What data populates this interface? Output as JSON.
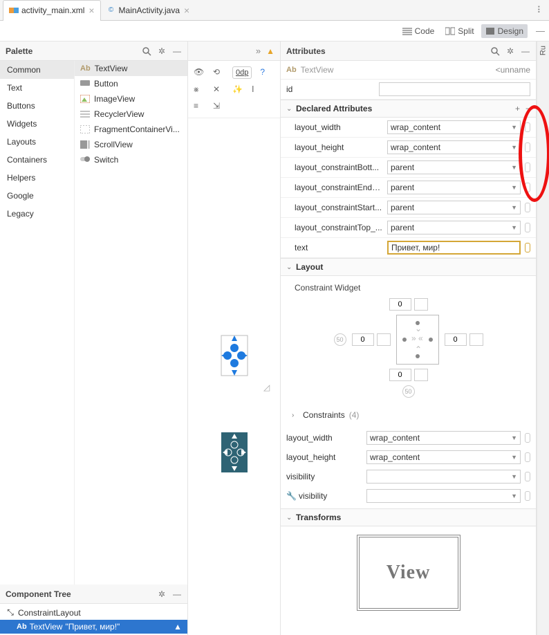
{
  "tabs": [
    {
      "label": "activity_main.xml",
      "active": true,
      "icon_color_a": "#ec9b3b",
      "icon_color_b": "#4aa0e0"
    },
    {
      "label": "MainActivity.java",
      "active": false
    }
  ],
  "right_panel_label": "Ru",
  "view_modes": {
    "code": "Code",
    "split": "Split",
    "design": "Design"
  },
  "palette": {
    "title": "Palette",
    "categories": [
      "Common",
      "Text",
      "Buttons",
      "Widgets",
      "Layouts",
      "Containers",
      "Helpers",
      "Google",
      "Legacy"
    ],
    "selected_category": "Common",
    "items": [
      "TextView",
      "Button",
      "ImageView",
      "RecyclerView",
      "FragmentContainerVi...",
      "ScrollView",
      "Switch"
    ],
    "selected_item": "TextView"
  },
  "component_tree": {
    "title": "Component Tree",
    "root": "ConstraintLayout",
    "child_label": "TextView",
    "child_text": "\"Привет, мир!\""
  },
  "canvas_toolbar": {
    "dp": "0dp"
  },
  "attributes": {
    "panel_title": "Attributes",
    "element_type": "TextView",
    "unnamed": "<unname",
    "id_label": "id",
    "id_value": "",
    "declared_title": "Declared Attributes",
    "declared": [
      {
        "name": "layout_width",
        "value": "wrap_content"
      },
      {
        "name": "layout_height",
        "value": "wrap_content"
      },
      {
        "name": "layout_constraintBott...",
        "value": "parent"
      },
      {
        "name": "layout_constraintEnd_...",
        "value": "parent"
      },
      {
        "name": "layout_constraintStart...",
        "value": "parent"
      },
      {
        "name": "layout_constraintTop_...",
        "value": "parent"
      }
    ],
    "text_attr": {
      "name": "text",
      "value": "Привет, мир!"
    },
    "layout_title": "Layout",
    "constraint_widget_title": "Constraint Widget",
    "cw_values": {
      "top": "0",
      "left": "0",
      "right": "0",
      "bottom": "0",
      "bias_v": "50",
      "bias_h": "50"
    },
    "constraints_title": "Constraints",
    "constraints_count": "(4)",
    "layout_attrs": [
      {
        "name": "layout_width",
        "value": "wrap_content"
      },
      {
        "name": "layout_height",
        "value": "wrap_content"
      },
      {
        "name": "visibility",
        "value": ""
      },
      {
        "name": "visibility",
        "value": "",
        "wrench": true
      }
    ],
    "transforms_title": "Transforms",
    "view_placeholder": "View"
  }
}
